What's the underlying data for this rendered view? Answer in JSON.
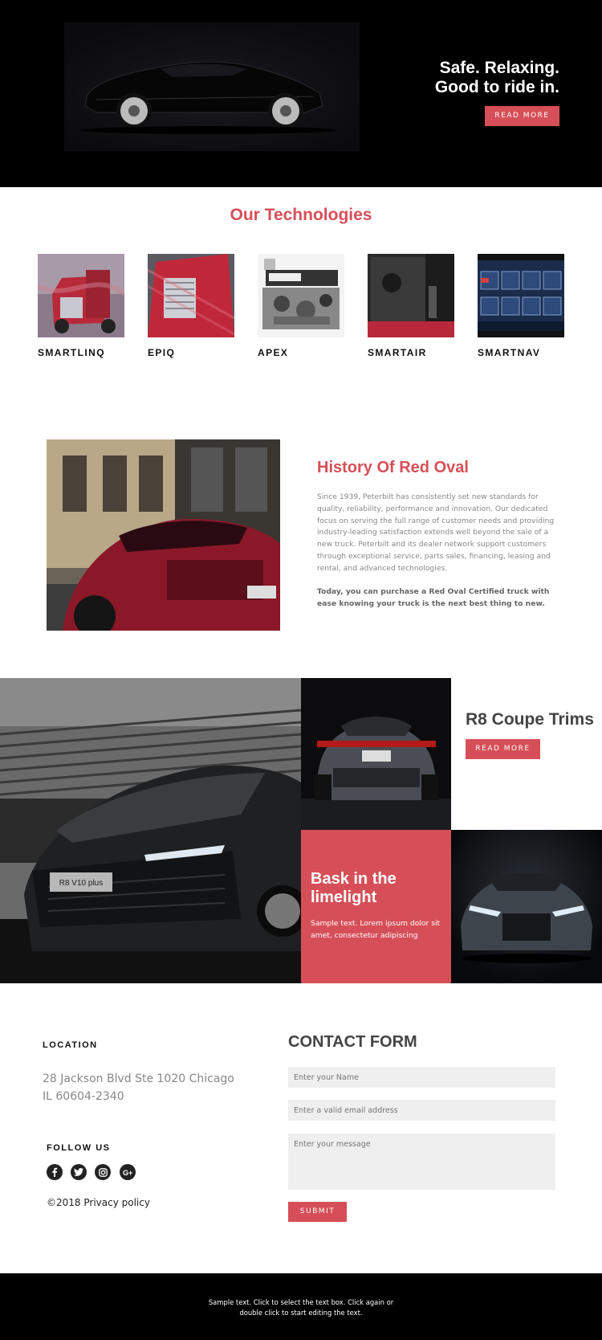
{
  "hero": {
    "title_line1": "Safe. Relaxing.",
    "title_line2": "Good to ride in.",
    "button_label": "READ MORE"
  },
  "technologies": {
    "title": "Our Technologies",
    "items": [
      {
        "label": "SMARTLINQ",
        "image": "red-truck-photo"
      },
      {
        "label": "EPIQ",
        "image": "red-truck-grille-photo"
      },
      {
        "label": "APEX",
        "image": "engine-photo"
      },
      {
        "label": "SMARTAIR",
        "image": "speaker-grille-photo"
      },
      {
        "label": "SMARTNAV",
        "image": "navigation-screen-photo"
      }
    ]
  },
  "history": {
    "title": "History Of Red Oval",
    "paragraph": "Since 1939, Peterbilt has consistently set new standards for quality, reliability, performance and innovation. Our dedicated focus on serving the full range of customer needs and providing industry-leading satisfaction extends well beyond the sale of a new truck. Peterbilt and its dealer network support customers through exceptional service, parts sales, financing, leasing and rental, and advanced technologies.",
    "bold_paragraph": "Today, you can purchase a Red Oval Certified truck with ease knowing your truck is the next best thing to new."
  },
  "gallery": {
    "plate_text": "R8 V10 plus",
    "trims_title": "R8 Coupe Trims",
    "trims_button": "READ MORE",
    "bask_title": "Bask in the limelight",
    "bask_text": "Sample text. Lorem ipsum dolor sit amet, consectetur adipiscing"
  },
  "contact": {
    "location_label": "LOCATION",
    "address_line1": "28 Jackson Blvd Ste 1020 Chicago",
    "address_line2": "IL 60604-2340",
    "follow_label": "FOLLOW US",
    "social_icons": [
      "facebook-icon",
      "twitter-icon",
      "instagram-icon",
      "google-plus-icon"
    ],
    "copyright": "©2018 Privacy policy",
    "form_title": "CONTACT FORM",
    "name_placeholder": "Enter your Name",
    "email_placeholder": "Enter a valid email address",
    "message_placeholder": "Enter your message",
    "submit_label": "SUBMIT"
  },
  "footer": {
    "text": "Sample text. Click to select the text box. Click again or double click to start editing the text."
  },
  "colors": {
    "accent": "#d64f58",
    "dark": "#000000",
    "field_bg": "#efefef"
  }
}
